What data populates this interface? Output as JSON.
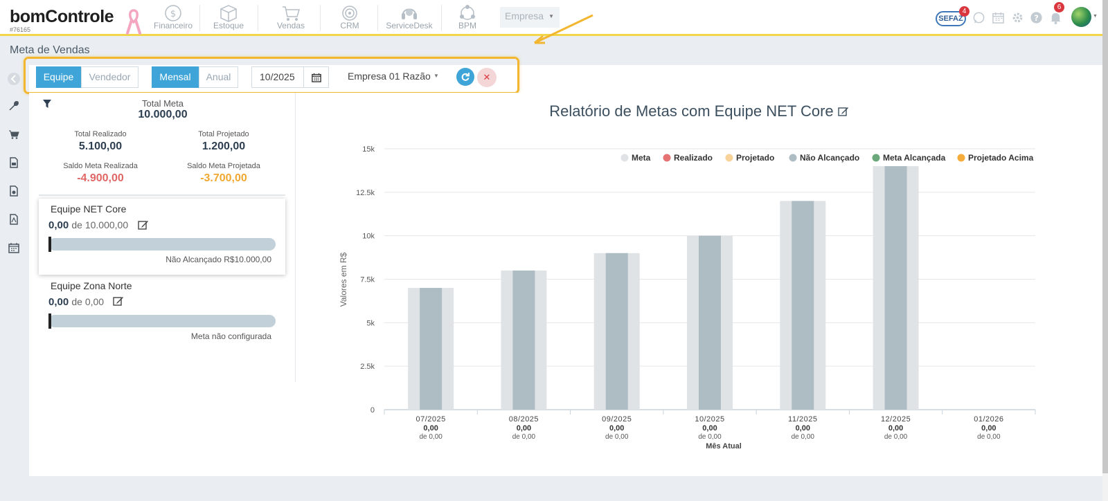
{
  "app": {
    "logo_text": "bomControle",
    "account_id": "#76165"
  },
  "nav": [
    {
      "label": "Financeiro",
      "icon": "dollar-coin-icon"
    },
    {
      "label": "Estoque",
      "icon": "box-icon"
    },
    {
      "label": "Vendas",
      "icon": "cart-icon"
    },
    {
      "label": "CRM",
      "icon": "target-icon"
    },
    {
      "label": "ServiceDesk",
      "icon": "headset-icon"
    },
    {
      "label": "BPM",
      "icon": "process-icon"
    }
  ],
  "empresa_selector": "Empresa",
  "top_icons": {
    "sefaz_label": "SEFAZ",
    "sefaz_badge": "4",
    "notifications_badge": "6"
  },
  "page_title": "Meta de Vendas",
  "filters": {
    "group_options": [
      "Equipe",
      "Vendedor"
    ],
    "group_selected": "Equipe",
    "period_options": [
      "Mensal",
      "Anual"
    ],
    "period_selected": "Mensal",
    "date_value": "10/2025",
    "company": "Empresa 01 Razão"
  },
  "summary": {
    "total_meta_label": "Total Meta",
    "total_meta_value": "10.000,00",
    "total_realizado_label": "Total Realizado",
    "total_realizado_value": "5.100,00",
    "total_projetado_label": "Total Projetado",
    "total_projetado_value": "1.200,00",
    "saldo_realizada_label": "Saldo Meta Realizada",
    "saldo_realizada_value": "-4.900,00",
    "saldo_projetada_label": "Saldo Meta Projetada",
    "saldo_projetada_value": "-3.700,00"
  },
  "teams": [
    {
      "name": "Equipe NET Core",
      "realizado": "0,00",
      "meta_text": "de 10.000,00",
      "status": "Não Alcançado R$10.000,00",
      "progress": 0
    },
    {
      "name": "Equipe Zona Norte",
      "realizado": "0,00",
      "meta_text": "de 0,00",
      "status": "Meta não configurada",
      "progress": 0
    }
  ],
  "colors": {
    "accent": "#3fa5d8",
    "negative": "#e06666",
    "warning": "#f0a830",
    "highlight_border": "#f2b630"
  },
  "chart_data": {
    "type": "bar",
    "title": "Relatório de Metas com Equipe NET Core",
    "ylabel": "Valores em R$",
    "xlabel": "Mês Atual",
    "ylim": [
      0,
      15000
    ],
    "yticks": [
      0,
      2500,
      5000,
      7500,
      10000,
      12500,
      15000
    ],
    "ytick_labels": [
      "0",
      "2.5k",
      "5k",
      "7.5k",
      "10k",
      "12.5k",
      "15k"
    ],
    "categories": [
      "07/2025",
      "08/2025",
      "09/2025",
      "10/2025",
      "11/2025",
      "12/2025",
      "01/2026"
    ],
    "category_realizado": [
      "0,00",
      "0,00",
      "0,00",
      "0,00",
      "0,00",
      "0,00",
      "0,00"
    ],
    "category_meta": [
      "de 0,00",
      "de 0,00",
      "de 0,00",
      "de 0,00",
      "de 0,00",
      "de 0,00",
      "de 0,00"
    ],
    "legend": [
      {
        "name": "Meta",
        "color": "#dfe3e6"
      },
      {
        "name": "Realizado",
        "color": "#e57373"
      },
      {
        "name": "Projetado",
        "color": "#f7d39a"
      },
      {
        "name": "Não Alcançado",
        "color": "#aebcc4"
      },
      {
        "name": "Meta Alcançada",
        "color": "#6aa77a"
      },
      {
        "name": "Projetado Acima",
        "color": "#f5ac3a"
      }
    ],
    "series": [
      {
        "name": "Meta",
        "values": [
          7000,
          8000,
          9000,
          10000,
          12000,
          14000,
          0
        ]
      },
      {
        "name": "Não Alcançado",
        "values": [
          7000,
          8000,
          9000,
          10000,
          12000,
          14000,
          0
        ]
      }
    ]
  }
}
